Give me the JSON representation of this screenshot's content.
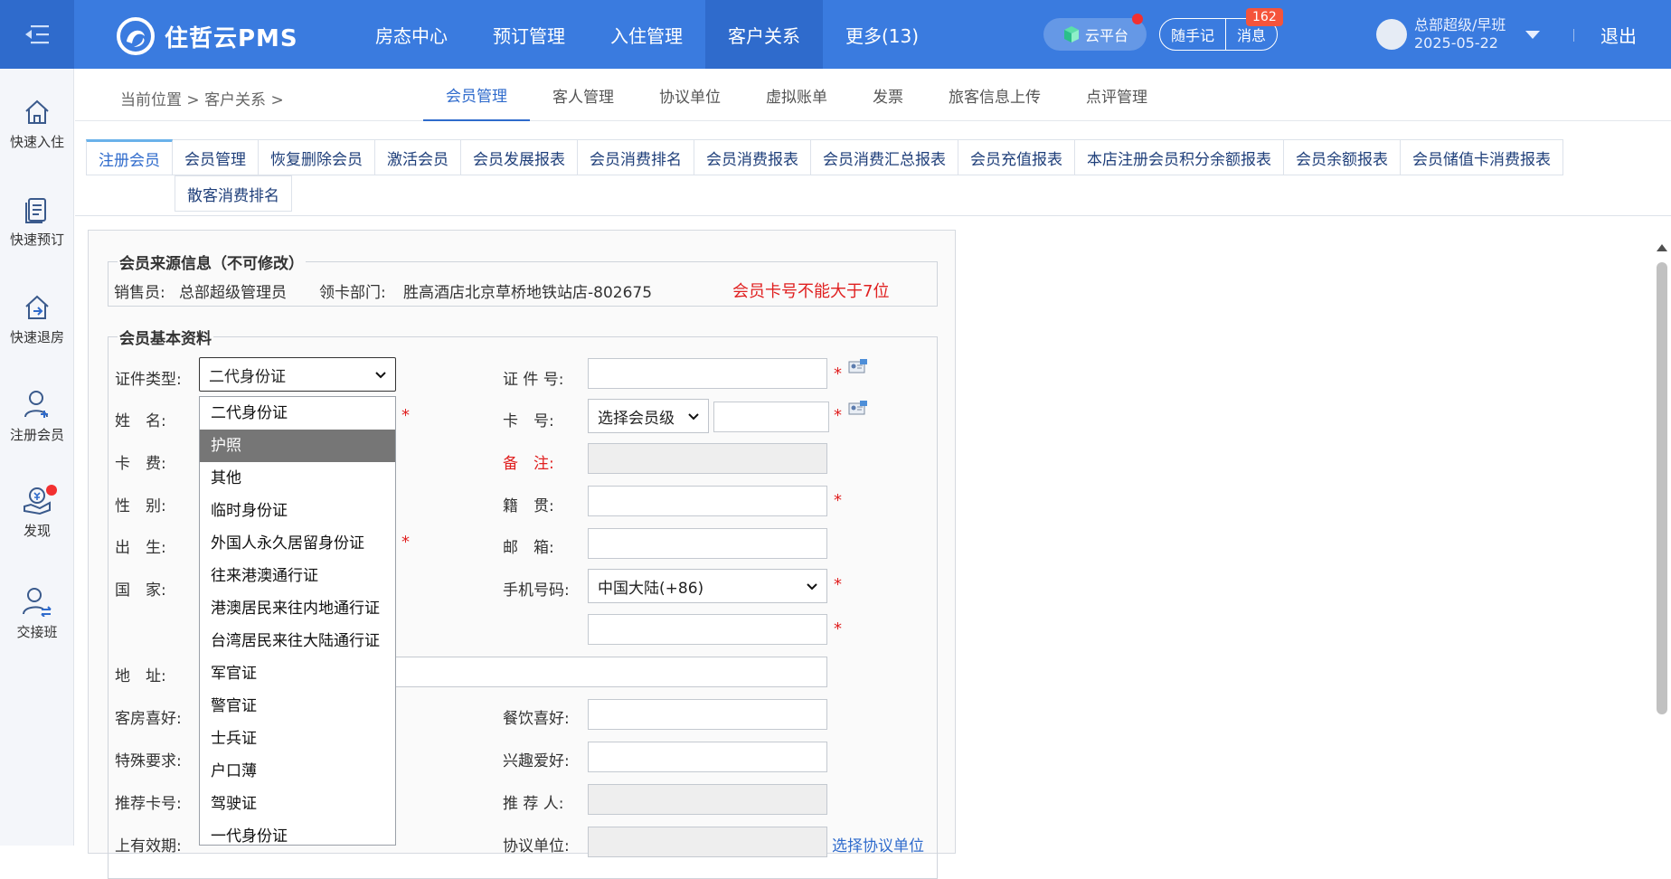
{
  "app": {
    "logo_text": "住哲云PMS"
  },
  "main_nav": [
    {
      "label": "房态中心"
    },
    {
      "label": "预订管理"
    },
    {
      "label": "入住管理"
    },
    {
      "label": "客户关系",
      "active": true
    },
    {
      "label": "更多(13)"
    }
  ],
  "header": {
    "cloud_label": "云平台",
    "note_label": "随手记",
    "msg_label": "消息",
    "msg_count": "162",
    "user_name": "总部超级/早班",
    "user_date": "2025-05-22",
    "logout_label": "退出"
  },
  "sidebar": [
    {
      "label": "快速入住",
      "icon": "home-in-icon"
    },
    {
      "label": "快速预订",
      "icon": "document-icon"
    },
    {
      "label": "快速退房",
      "icon": "home-out-icon"
    },
    {
      "label": "注册会员",
      "icon": "user-add-icon"
    },
    {
      "label": "发现",
      "icon": "discover-icon"
    },
    {
      "label": "交接班",
      "icon": "handover-icon"
    }
  ],
  "breadcrumb": {
    "prefix": "当前位置",
    "sep": ">",
    "section": "客户关系",
    "tail": ">"
  },
  "sub_tabs": [
    {
      "label": "会员管理",
      "active": true
    },
    {
      "label": "客人管理"
    },
    {
      "label": "协议单位"
    },
    {
      "label": "虚拟账单"
    },
    {
      "label": "发票"
    },
    {
      "label": "旅客信息上传"
    },
    {
      "label": "点评管理"
    }
  ],
  "function_tabs_row1": [
    {
      "label": "注册会员",
      "active": true
    },
    {
      "label": "会员管理"
    },
    {
      "label": "恢复删除会员"
    },
    {
      "label": "激活会员"
    },
    {
      "label": "会员发展报表"
    },
    {
      "label": "会员消费排名"
    },
    {
      "label": "会员消费报表"
    },
    {
      "label": "会员消费汇总报表"
    },
    {
      "label": "会员充值报表"
    },
    {
      "label": "本店注册会员积分余额报表"
    },
    {
      "label": "会员余额报表"
    },
    {
      "label": "会员储值卡消费报表"
    }
  ],
  "function_tabs_row2": [
    {
      "label": "散客消费排名"
    }
  ],
  "source_info": {
    "legend": "会员来源信息（不可修改）",
    "sales_label": "销售员:",
    "sales_value": "总部超级管理员",
    "dept_label": "领卡部门:",
    "dept_value": "胜高酒店北京草桥地铁站店-802675",
    "warning": "会员卡号不能大于7位"
  },
  "basic_info": {
    "legend": "会员基本资料",
    "id_type_label": "证件类型:",
    "id_type_value": "二代身份证",
    "id_no_label": "证 件 号:",
    "name_label": "姓　名:",
    "card_no_label": "卡　号:",
    "card_level_placeholder": "选择会员级",
    "card_fee_label": "卡　费:",
    "remark_label": "备　注:",
    "gender_label": "性　别:",
    "native_label": "籍　贯:",
    "birth_label": "出　生:",
    "email_label": "邮　箱:",
    "country_label": "国　家:",
    "phone_label": "手机号码:",
    "phone_region": "中国大陆(+86)",
    "address_label": "地　址:",
    "room_pref_label": "客房喜好:",
    "food_pref_label": "餐饮喜好:",
    "special_label": "特殊要求:",
    "hobby_label": "兴趣爱好:",
    "ref_card_label": "推荐卡号:",
    "referrer_label": "推 荐 人:",
    "valid_label": "上有效期:",
    "agreement_label": "协议单位:",
    "agreement_link": "选择协议单位",
    "required_mark": "*"
  },
  "id_type_options": [
    {
      "label": "二代身份证"
    },
    {
      "label": "护照",
      "highlighted": true
    },
    {
      "label": "其他"
    },
    {
      "label": "临时身份证"
    },
    {
      "label": "外国人永久居留身份证"
    },
    {
      "label": "往来港澳通行证"
    },
    {
      "label": "港澳居民来往内地通行证"
    },
    {
      "label": "台湾居民来往大陆通行证"
    },
    {
      "label": "军官证"
    },
    {
      "label": "警官证"
    },
    {
      "label": "士兵证"
    },
    {
      "label": "户口薄"
    },
    {
      "label": "驾驶证"
    },
    {
      "label": "一代身份证"
    }
  ],
  "colors": {
    "header_bg": "#3a7bdf",
    "header_active": "#2f6bcc",
    "accent": "#2f6bcc",
    "required": "#e02020",
    "highlight_option": "#767676"
  }
}
